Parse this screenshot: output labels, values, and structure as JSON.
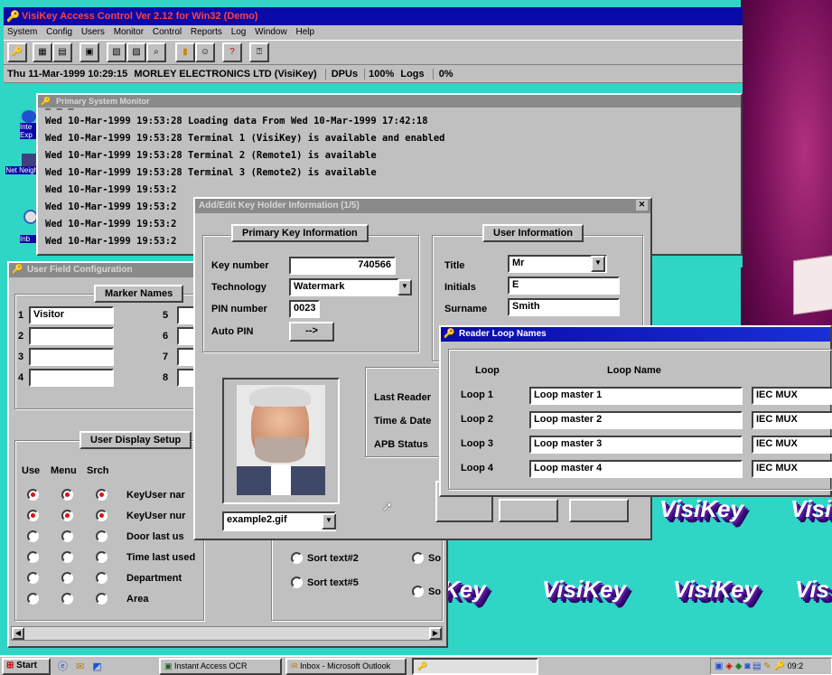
{
  "main_window": {
    "title": "VisiKey Access Control  Ver 2.12  for Win32  (Demo)",
    "menu": [
      "System",
      "Config",
      "Users",
      "Monitor",
      "Control",
      "Reports",
      "Log",
      "Window",
      "Help"
    ],
    "status": {
      "datetime": "Thu 11-Mar-1999 10:29:15",
      "company": "MORLEY ELECTRONICS LTD (VisiKey)",
      "dpus_label": "DPUs",
      "dpus_value": "100%",
      "logs_label": "Logs",
      "logs_value": "0%"
    }
  },
  "monitor": {
    "title": "Primary System Monitor",
    "lines": [
      "Wed 10-Mar-1999 19:53:28 Loading data From Wed 10-Mar-1999 17:42:18",
      "Wed 10-Mar-1999 19:53:28 Terminal 1 (VisiKey) is available and enabled",
      "Wed 10-Mar-1999 19:53:28 Terminal 2 (Remote1) is available",
      "Wed 10-Mar-1999 19:53:28 Terminal 3 (Remote2) is available",
      "Wed 10-Mar-1999 19:53:2",
      "Wed 10-Mar-1999 19:53:2",
      "Wed 10-Mar-1999 19:53:2",
      "Wed 10-Mar-1999 19:53:2"
    ]
  },
  "user_field": {
    "title": "User Field Configuration",
    "marker_names_title": "Marker Names",
    "markers": [
      {
        "num": "1",
        "value": "Visitor"
      },
      {
        "num": "2",
        "value": ""
      },
      {
        "num": "3",
        "value": ""
      },
      {
        "num": "4",
        "value": ""
      },
      {
        "num": "5",
        "value": ""
      },
      {
        "num": "6",
        "value": ""
      },
      {
        "num": "7",
        "value": ""
      },
      {
        "num": "8",
        "value": ""
      }
    ],
    "display_setup_title": "User Display Setup",
    "col_use": "Use",
    "col_menu": "Menu",
    "col_srch": "Srch",
    "rows": [
      {
        "label": "KeyUser nar",
        "use": true,
        "menu": true,
        "srch": true
      },
      {
        "label": "KeyUser nur",
        "use": true,
        "menu": true,
        "srch": true
      },
      {
        "label": "Door last us",
        "use": false,
        "menu": false,
        "srch": false
      },
      {
        "label": "Time last used",
        "use": false,
        "menu": false,
        "srch": false
      },
      {
        "label": "Department",
        "use": false,
        "menu": false,
        "srch": false
      },
      {
        "label": "Area",
        "use": false,
        "menu": false,
        "srch": false
      }
    ]
  },
  "keyholder": {
    "title": "Add/Edit Key Holder Information (1/5)",
    "primary_title": "Primary Key Information",
    "key_number_label": "Key number",
    "key_number": "740566",
    "technology_label": "Technology",
    "technology": "Watermark",
    "pin_label": "PIN number",
    "pin": "0023",
    "auto_pin_label": "Auto PIN",
    "auto_pin_button": "-->",
    "user_info_title": "User Information",
    "title_label": "Title",
    "title_value": "Mr",
    "initials_label": "Initials",
    "initials": "E",
    "surname_label": "Surname",
    "surname": "Smith",
    "last_reader_label": "Last Reader",
    "time_date_label": "Time & Date",
    "apb_label": "APB Status",
    "photo_file": "example2.gif",
    "sort_text_2": "Sort text#2",
    "sort_text_5": "Sort text#5",
    "sort_partial_a": "So",
    "sort_partial_b": "So"
  },
  "reader_loop": {
    "title": "Reader Loop Names",
    "col_loop": "Loop",
    "col_name": "Loop Name",
    "loops": [
      {
        "loop": "Loop 1",
        "name": "Loop master 1",
        "type": "IEC MUX"
      },
      {
        "loop": "Loop 2",
        "name": "Loop master 2",
        "type": "IEC MUX"
      },
      {
        "loop": "Loop 3",
        "name": "Loop master 3",
        "type": "IEC MUX"
      },
      {
        "loop": "Loop 4",
        "name": "Loop master 4",
        "type": "IEC MUX"
      }
    ]
  },
  "desktop": {
    "icon_labels": [
      "Inte Exp",
      "Net Neigh",
      "Inb"
    ],
    "wallpaper_text": [
      "VisiKey",
      "VisiKey",
      "VisiKey",
      "Visi",
      "Key",
      "VisiKey",
      "VisiKey",
      "Vis"
    ]
  },
  "taskbar": {
    "start_label": "Start",
    "items": [
      "Instant Access OCR",
      "Inbox - Microsoft Outlook",
      ""
    ],
    "clock": "09:2"
  },
  "colors": {
    "desktop": "#2fd6c6",
    "title_active": "#0a0aa8",
    "purple_photo": "#7a1a60"
  }
}
